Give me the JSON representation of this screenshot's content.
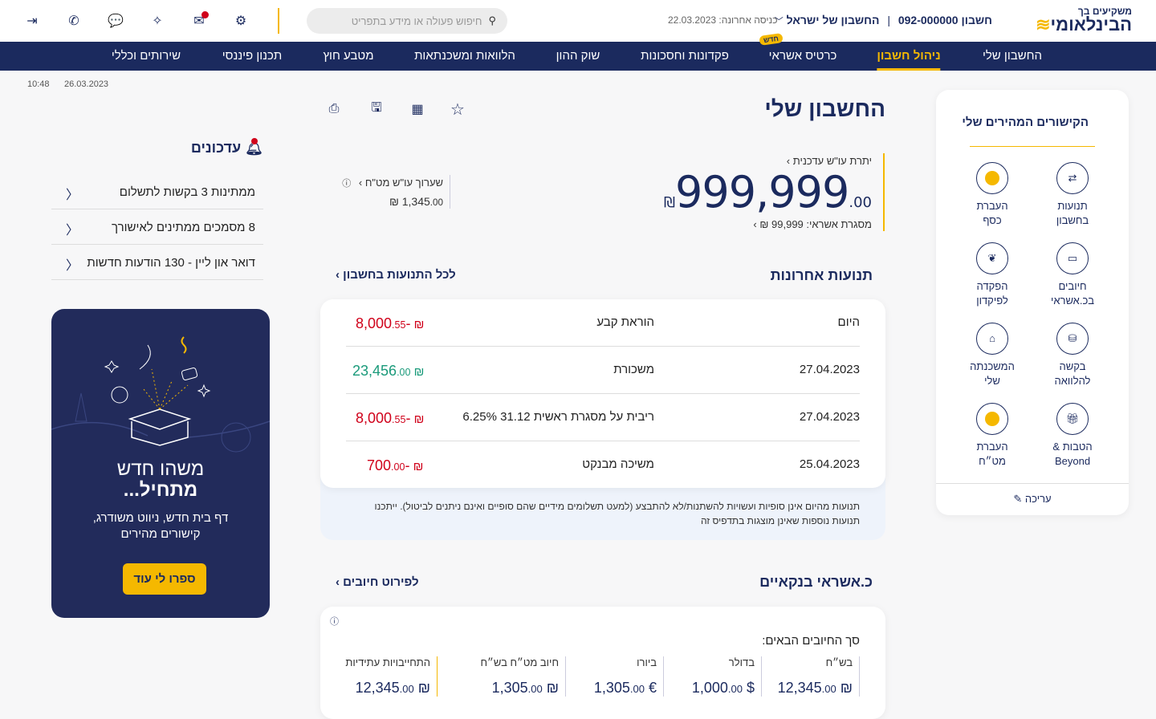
{
  "header": {
    "logo_top": "משקיעים בך",
    "logo_main": "הבינלאומי",
    "account": "חשבון 092-000000",
    "account_name": "החשבון של ישראל",
    "last_login": "כניסה אחרונה: 22.03.2023",
    "search_placeholder": "חיפוש פעולה או מידע בתפריט"
  },
  "nav": {
    "items": [
      "החשבון שלי",
      "ניהול חשבון",
      "כרטיס אשראי",
      "פקדונות וחסכונות",
      "שוק ההון",
      "הלוואות ומשכנתאות",
      "מטבע חוץ",
      "תכנון פיננסי",
      "שירותים וכללי"
    ],
    "badge": "חדש"
  },
  "datetime": {
    "date": "26.03.2023",
    "time": "10:48"
  },
  "quick_links": {
    "title": "הקישורים המהירים שלי",
    "items": [
      [
        "תנועות",
        "בחשבון"
      ],
      [
        "העברת",
        "כסף"
      ],
      [
        "חיובים",
        "בכ.אשראי"
      ],
      [
        "הפקדה",
        "לפיקדון"
      ],
      [
        "בקשה",
        "להלוואה"
      ],
      [
        "המשכנתה",
        "שלי"
      ],
      [
        "הטבות &",
        "Beyond"
      ],
      [
        "העברת",
        "מט״ח"
      ]
    ],
    "edit": "עריכה"
  },
  "main": {
    "title": "החשבון שלי",
    "balance_label": "יתרת עו\"ש עדכנית",
    "balance": "999,999",
    "balance_cents": ".00",
    "currency": "₪",
    "credit_limit": "מסגרת אשראי: 99,999 ₪",
    "fx_label": "שערוך עו\"ש מט\"ח",
    "fx_value": "1,345",
    "fx_cents": ".00"
  },
  "transactions": {
    "title": "תנועות אחרונות",
    "all_link": "לכל התנועות בחשבון",
    "rows": [
      {
        "date": "היום",
        "desc": "הוראת קבע",
        "amount": "-8,000",
        "cents": ".55",
        "type": "neg"
      },
      {
        "date": "27.04.2023",
        "desc": "משכורת",
        "amount": "23,456",
        "cents": ".00",
        "type": "pos"
      },
      {
        "date": "27.04.2023",
        "desc": "6.25% 31.12 ריבית על מסגרת ראשית",
        "amount": "-8,000",
        "cents": ".55",
        "type": "neg"
      },
      {
        "date": "25.04.2023",
        "desc": "משיכה מבנקט",
        "amount": "-700",
        "cents": ".00",
        "type": "neg"
      }
    ],
    "note1": "תנועות מהיום אינן סופיות ועשויות להשתנות/לא להתבצע (למעט תשלומים מידיים שהם סופיים ואינם ניתנים לביטול). ייתכנו",
    "note2": "תנועות נוספות שאינן מוצגות בתדפיס זה"
  },
  "credit": {
    "title": "כ.אשראי בנקאיים",
    "link": "לפירוט חיובים",
    "subtitle": "סך החיובים הבאים:",
    "cols": [
      {
        "label": "בש״ח",
        "value": "₪ 12,345",
        "cents": ".00"
      },
      {
        "label": "בדולר",
        "value": "$ 1,000",
        "cents": ".00"
      },
      {
        "label": "ביורו",
        "value": "€ 1,305",
        "cents": ".00"
      },
      {
        "label": "חיוב מט״ח בש״ח",
        "value": "₪ 1,305",
        "cents": ".00"
      },
      {
        "label": "התחייבויות עתידיות",
        "value": "₪ 12,345",
        "cents": ".00"
      }
    ]
  },
  "updates": {
    "title": "עדכונים",
    "items": [
      "ממתינות 3 בקשות לתשלום",
      "8 מסמכים ממתינים לאישורך",
      "דואר און ליין - 130 הודעות חדשות"
    ]
  },
  "promo": {
    "title1": "משהו חדש",
    "title2": "מתחיל...",
    "text1": "דף בית חדש, ניווט משודרג,",
    "text2": "קישורים מהירים",
    "button": "ספרו לי עוד"
  },
  "colors": {
    "navy": "#1b2a5e",
    "yellow": "#f5b800",
    "red": "#d0021b",
    "green": "#1a9a7a"
  }
}
